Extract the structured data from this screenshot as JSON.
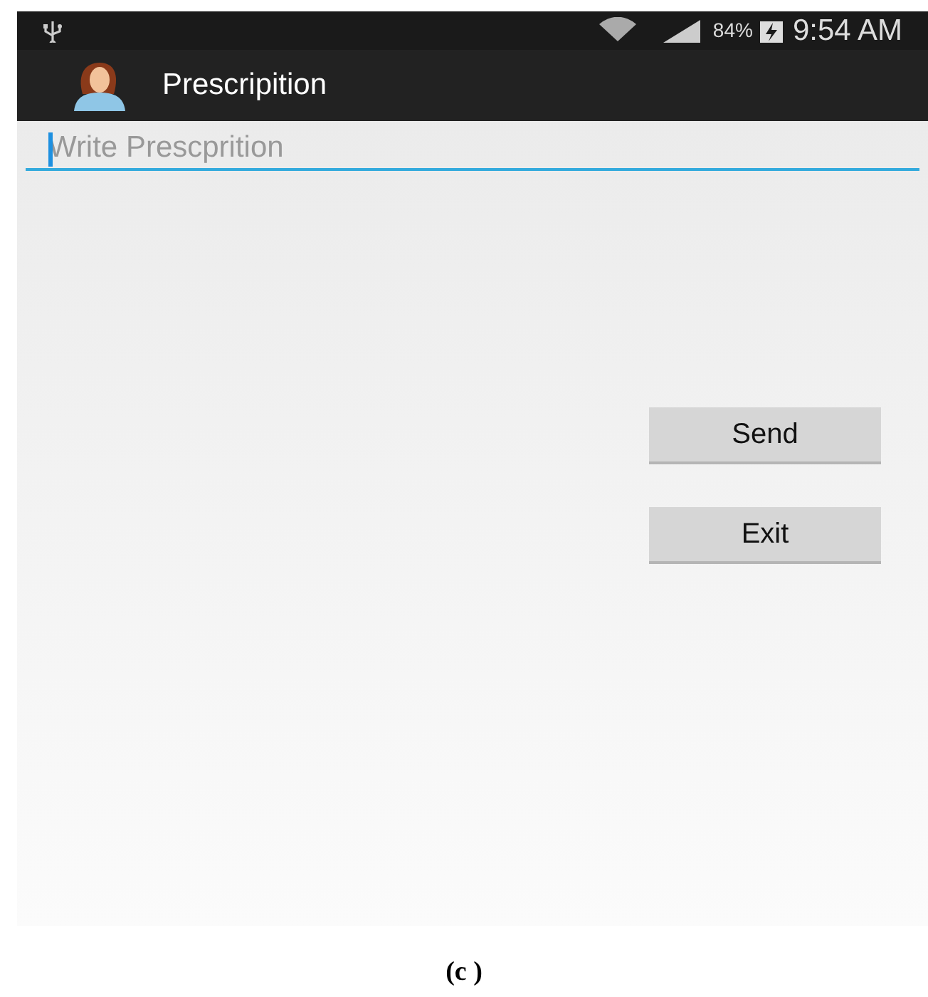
{
  "status_bar": {
    "battery_percent": "84%",
    "time": "9:54 AM"
  },
  "action_bar": {
    "title": "Prescripition"
  },
  "prescription_field": {
    "placeholder": "Write Prescprition"
  },
  "buttons": [
    "Send",
    "Exit"
  ],
  "caption": "(c )"
}
